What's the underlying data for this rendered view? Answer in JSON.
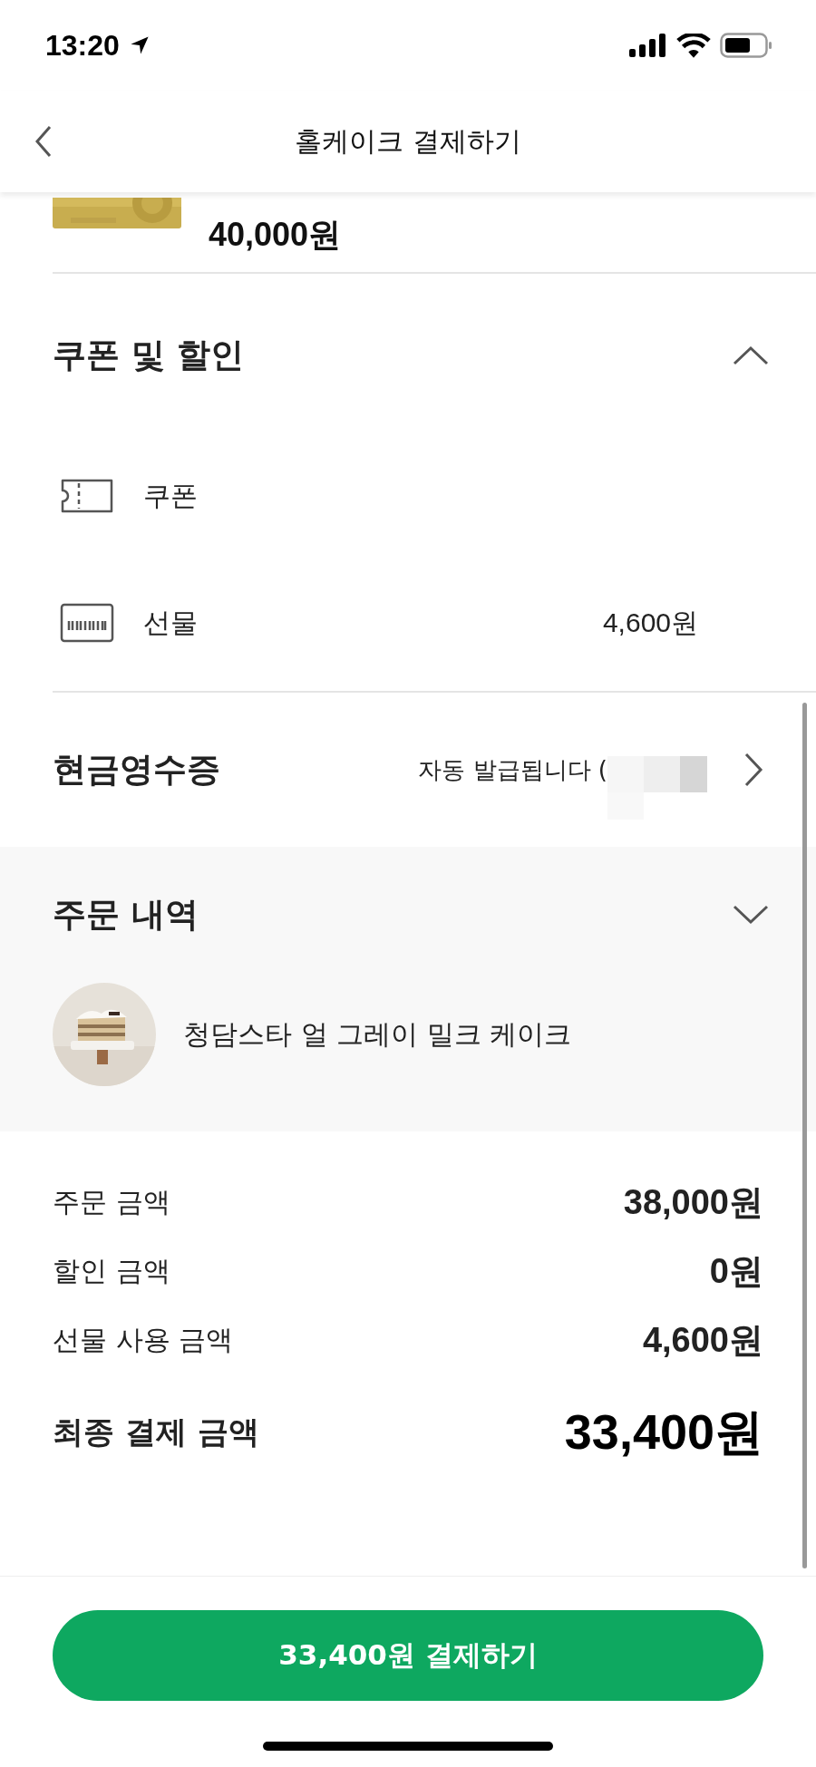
{
  "status_bar": {
    "time": "13:20"
  },
  "header": {
    "title": "홀케이크 결제하기"
  },
  "card": {
    "amount": "40,000원"
  },
  "discounts": {
    "title": "쿠폰 및 할인",
    "expanded": true,
    "items": [
      {
        "kind": "coupon",
        "label": "쿠폰"
      },
      {
        "kind": "gift",
        "label": "선물",
        "value": "4,600원"
      }
    ]
  },
  "cash_receipt": {
    "title": "현금영수증",
    "value": "자동 발급됩니다 ("
  },
  "order": {
    "title": "주문 내역",
    "items": [
      {
        "name": "청담스타 얼 그레이 밀크 케이크"
      }
    ]
  },
  "summary": [
    {
      "kind": "normal",
      "label": "주문 금액",
      "value": "38,000원"
    },
    {
      "kind": "normal",
      "label": "할인 금액",
      "value": "0원"
    },
    {
      "kind": "normal",
      "label": "선물 사용 금액",
      "value": "4,600원"
    },
    {
      "kind": "total",
      "label": "최종 결제 금액",
      "value": "33,400원"
    }
  ],
  "pay_button": {
    "label": "33,400원 결제하기"
  }
}
